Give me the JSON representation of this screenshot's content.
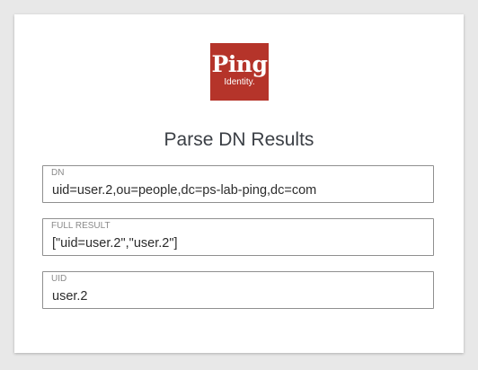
{
  "logo": {
    "word": "Ping",
    "sub": "Identity.",
    "brand_color": "#b5342a"
  },
  "title": "Parse DN Results",
  "fields": {
    "dn": {
      "label": "DN",
      "value": "uid=user.2,ou=people,dc=ps-lab-ping,dc=com"
    },
    "full": {
      "label": "FULL RESULT",
      "value": "[\"uid=user.2\",\"user.2\"]"
    },
    "uid": {
      "label": "UID",
      "value": "user.2"
    }
  }
}
